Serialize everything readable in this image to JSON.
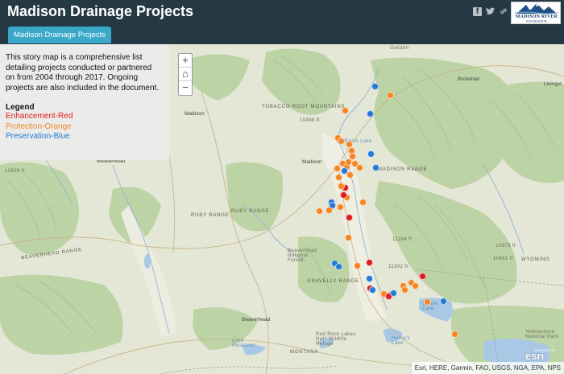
{
  "header": {
    "title": "Madison Drainage Projects",
    "share_icons": [
      "facebook-icon",
      "twitter-icon",
      "link-icon"
    ],
    "logo": {
      "line1": "MADISON RIVER",
      "line2": "FOUNDATION"
    }
  },
  "tabs": [
    {
      "label": "Madison Drainage Projects"
    }
  ],
  "zoom": {
    "plus": "+",
    "home": "⌂",
    "minus": "−"
  },
  "panel": {
    "description": "This story map is a comprehensive list detailing projects conducted or partnered on from 2004 through 2017. Ongoing projects are also included in the document.",
    "legend_title": "Legend",
    "legend_items": [
      {
        "label": "Enhancement-Red",
        "color": "#e0191f"
      },
      {
        "label": "Protection-Orange",
        "color": "#f58422"
      },
      {
        "label": "Preservation-Blue",
        "color": "#2478d6"
      }
    ]
  },
  "map_labels": {
    "gallatin": "Gallatin",
    "bozeman": "Bozeman",
    "livingston": "Livingst",
    "tobacco_root": "TOBACCO ROOT MOUNTAINS",
    "madison_1": "Madison",
    "elev_10498": "10498 ft",
    "ennis_lake": "Ennis Lake",
    "beaverhead_1": "Beaverhead",
    "madison_2": "Madison",
    "madison_range": "MADISON RANGE",
    "elev_10626": "10626 ft",
    "ruby_range": "RUBY RANGE",
    "ruby_range_2": "RUBY RANGE",
    "elev_11284": "11284 ft",
    "elev_10973": "10973 ft",
    "beaverhead_forest": "Beaverhead National Forest",
    "gravelly_range": "GRAVELLY RANGE",
    "elev_11302": "11302 ft",
    "elev_10461": "10461 ft",
    "wyoming": "WYOMING",
    "beaverhead_range": "BEAVERHEAD RANGE",
    "beaverhead_2": "Beaverhead",
    "quake_lake": "Quake Lake",
    "red_rock": "Red Rock Lakes Nat'l Wildlife Refuge",
    "lima": "Lima Reservoir",
    "henrys": "Henry's Lake",
    "yellowstone": "Yellowstone National Park",
    "montana": "MONTANA"
  },
  "attribution": "Esri, HERE, Garmin, FAO, USGS, NGA, EPA, NPS",
  "esri_logo": {
    "word": "esri",
    "caption": "POWERED BY"
  },
  "projects": [
    {
      "category": "Preservation-Blue"
    },
    {
      "category": "Protection-Orange"
    },
    {
      "category": "Protection-Orange"
    },
    {
      "category": "Preservation-Blue"
    },
    {
      "category": "Preservation-Blue"
    },
    {
      "category": "Protection-Orange"
    },
    {
      "category": "Protection-Orange"
    },
    {
      "category": "Protection-Orange"
    },
    {
      "category": "Protection-Orange"
    },
    {
      "category": "Protection-Orange"
    },
    {
      "category": "Protection-Orange"
    },
    {
      "category": "Protection-Orange"
    },
    {
      "category": "Protection-Orange"
    },
    {
      "category": "Protection-Orange"
    },
    {
      "category": "Preservation-Blue"
    },
    {
      "category": "Protection-Orange"
    },
    {
      "category": "Protection-Orange"
    },
    {
      "category": "Protection-Orange"
    },
    {
      "category": "Enhancement-Red"
    },
    {
      "category": "Protection-Orange"
    },
    {
      "category": "Preservation-Blue"
    },
    {
      "category": "Protection-Orange"
    },
    {
      "category": "Preservation-Blue"
    },
    {
      "category": "Preservation-Blue"
    },
    {
      "category": "Protection-Orange"
    },
    {
      "category": "Enhancement-Red"
    },
    {
      "category": "Protection-Orange"
    },
    {
      "category": "Protection-Orange"
    },
    {
      "category": "Protection-Orange"
    },
    {
      "category": "Enhancement-Red"
    },
    {
      "category": "Protection-Orange"
    },
    {
      "category": "Preservation-Blue"
    },
    {
      "category": "Preservation-Blue"
    },
    {
      "category": "Protection-Orange"
    },
    {
      "category": "Enhancement-Red"
    },
    {
      "category": "Protection-Orange"
    },
    {
      "category": "Preservation-Blue"
    },
    {
      "category": "Enhancement-Red"
    },
    {
      "category": "Protection-Orange"
    },
    {
      "category": "Protection-Orange"
    },
    {
      "category": "Enhancement-Red"
    },
    {
      "category": "Protection-Orange"
    },
    {
      "category": "Protection-Orange"
    },
    {
      "category": "Protection-Orange"
    },
    {
      "category": "Protection-Orange"
    },
    {
      "category": "Enhancement-Red"
    },
    {
      "category": "Preservation-Blue"
    },
    {
      "category": "Preservation-Blue"
    },
    {
      "category": "Protection-Orange"
    },
    {
      "category": "Preservation-Blue"
    },
    {
      "category": "Protection-Orange"
    }
  ]
}
